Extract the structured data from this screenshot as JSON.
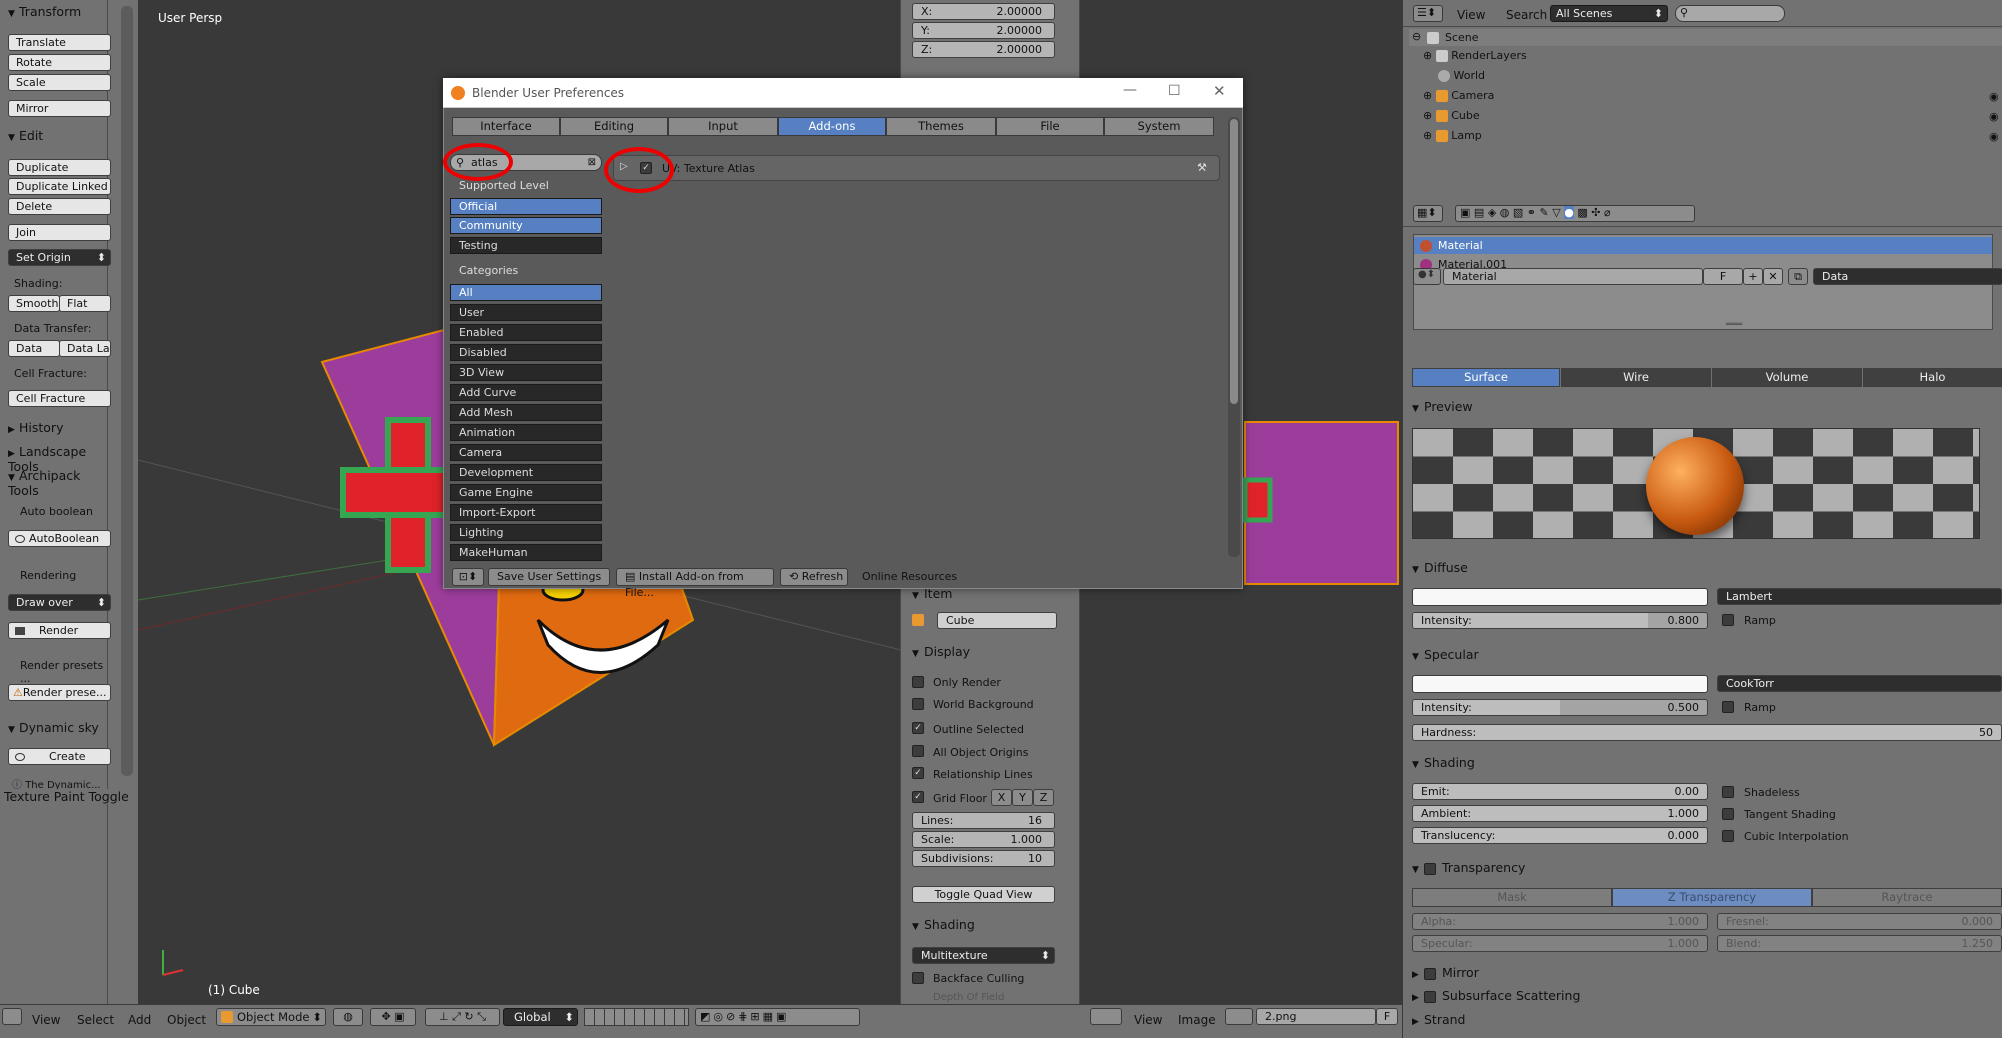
{
  "toolshelf": {
    "transform_title": "Transform",
    "translate": "Translate",
    "rotate": "Rotate",
    "scale": "Scale",
    "mirror": "Mirror",
    "edit_title": "Edit",
    "duplicate": "Duplicate",
    "duplicate_linked": "Duplicate Linked",
    "delete": "Delete",
    "join": "Join",
    "set_origin": "Set Origin",
    "shading_label": "Shading:",
    "smooth": "Smooth",
    "flat": "Flat",
    "data_transfer_label": "Data Transfer:",
    "data": "Data",
    "data_la": "Data La",
    "cell_fracture_label": "Cell Fracture:",
    "cell_fracture": "Cell Fracture",
    "history": "History",
    "landscape_tools": "Landscape Tools",
    "archipack_tools": "Archipack Tools",
    "auto_boolean_label": "Auto boolean",
    "autoboolean": "AutoBoolean",
    "rendering_label": "Rendering",
    "draw_over": "Draw over",
    "render": "Render",
    "render_presets_label": "Render presets ...",
    "render_prese": "Render prese...",
    "dynamic_sky": "Dynamic sky",
    "create": "Create",
    "the_dynamic": "The Dynamic...",
    "texture_paint_toggle": "Texture Paint Toggle"
  },
  "viewport": {
    "label": "User Persp",
    "object_label": "(1) Cube"
  },
  "npanel": {
    "x_label": "X:",
    "x_value": "2.00000",
    "y_label": "Y:",
    "y_value": "2.00000",
    "z_label": "Z:",
    "z_value": "2.00000",
    "item_title": "Item",
    "item_name": "Cube",
    "display_title": "Display",
    "only_render": "Only Render",
    "world_background": "World Background",
    "outline_selected": "Outline Selected",
    "all_object_origins": "All Object Origins",
    "relationship_lines": "Relationship Lines",
    "grid_floor": "Grid Floor",
    "gx": "X",
    "gy": "Y",
    "gz": "Z",
    "lines_label": "Lines:",
    "lines_value": "16",
    "scale_label": "Scale:",
    "scale_value": "1.000",
    "subdiv_label": "Subdivisions:",
    "subdiv_value": "10",
    "toggle_quad": "Toggle Quad View",
    "shading_title": "Shading",
    "multitexture": "Multitexture",
    "backface_culling": "Backface Culling",
    "depth_of_field": "Depth Of Field"
  },
  "dialog": {
    "title": "Blender User Preferences",
    "tabs": [
      "Interface",
      "Editing",
      "Input",
      "Add-ons",
      "Themes",
      "File",
      "System"
    ],
    "search_value": "atlas",
    "supported_level": "Supported Level",
    "levels": [
      "Official",
      "Community",
      "Testing"
    ],
    "categories_label": "Categories",
    "categories": [
      "All",
      "User",
      "Enabled",
      "Disabled",
      "3D View",
      "Add Curve",
      "Add Mesh",
      "Animation",
      "Camera",
      "Development",
      "Game Engine",
      "Import-Export",
      "Lighting",
      "MakeHuman"
    ],
    "addon_name": "UV: Texture Atlas",
    "save_settings": "Save User Settings",
    "install_addon": "Install Add-on from File...",
    "refresh": "Refresh",
    "online_resources": "Online Resources"
  },
  "outliner": {
    "view": "View",
    "search": "Search",
    "scenes_select": "All Scenes",
    "items": [
      "Scene",
      "RenderLayers",
      "World",
      "Camera",
      "Cube",
      "Lamp"
    ]
  },
  "properties": {
    "materials": [
      "Material",
      "Material.001"
    ],
    "material_name": "Material",
    "f_label": "F",
    "data_select": "Data",
    "tabs": [
      "Surface",
      "Wire",
      "Volume",
      "Halo"
    ],
    "preview_title": "Preview",
    "diffuse_title": "Diffuse",
    "lambert": "Lambert",
    "diffuse_intensity_label": "Intensity:",
    "diffuse_intensity": 0.8,
    "diffuse_intensity_text": "0.800",
    "ramp": "Ramp",
    "specular_title": "Specular",
    "cooktorr": "CookTorr",
    "specular_intensity_label": "Intensity:",
    "specular_intensity": 0.5,
    "specular_intensity_text": "0.500",
    "hardness_label": "Hardness:",
    "hardness_value": "50",
    "shading_title": "Shading",
    "emit_label": "Emit:",
    "emit_value": "0.00",
    "ambient_label": "Ambient:",
    "ambient_value": "1.000",
    "translucency_label": "Translucency:",
    "translucency_value": "0.000",
    "shadeless": "Shadeless",
    "tangent_shading": "Tangent Shading",
    "cubic_interpolation": "Cubic Interpolation",
    "transparency_title": "Transparency",
    "trans_tabs": [
      "Mask",
      "Z Transparency",
      "Raytrace"
    ],
    "alpha_label": "Alpha:",
    "alpha_value": "1.000",
    "fresnel_label": "Fresnel:",
    "fresnel_value": "0.000",
    "specular_label": "Specular:",
    "specular_value": "1.000",
    "blend_label": "Blend:",
    "blend_value": "1.250",
    "mirror_title": "Mirror",
    "sss_title": "Subsurface Scattering",
    "strand_title": "Strand"
  },
  "bottombar": {
    "view": "View",
    "select": "Select",
    "add": "Add",
    "object": "Object",
    "mode": "Object Mode",
    "global": "Global",
    "view2": "View",
    "image": "Image",
    "image_name": "2.png",
    "f": "F"
  },
  "colors": {
    "accent": "#5680c2",
    "annotation_red": "#ee0000"
  }
}
